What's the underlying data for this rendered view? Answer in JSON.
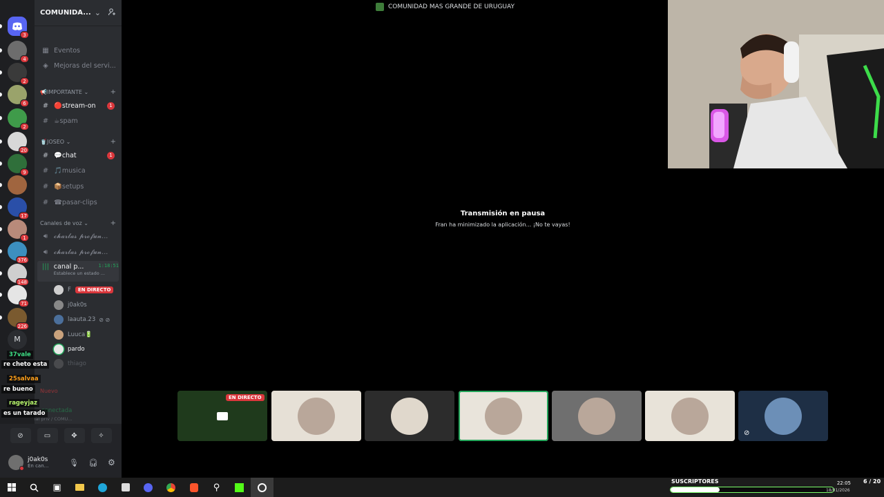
{
  "server_rail": {
    "servers": [
      {
        "name": "discord-home",
        "badge": "3",
        "color": "#5865f2"
      },
      {
        "name": "server-1",
        "badge": "4",
        "color": "#6d6d6d"
      },
      {
        "name": "server-2",
        "badge": "2",
        "color": "#3a3a3a"
      },
      {
        "name": "server-3",
        "badge": "6",
        "color": "#9aa36b"
      },
      {
        "name": "server-4",
        "badge": "2",
        "color": "#3f9b4a"
      },
      {
        "name": "server-5",
        "badge": "20",
        "color": "#d8d8d8"
      },
      {
        "name": "server-6",
        "badge": "9",
        "color": "#2f6f3a"
      },
      {
        "name": "server-7",
        "badge": "",
        "color": "#a0653f"
      },
      {
        "name": "server-8",
        "badge": "17",
        "color": "#2a4fa8"
      },
      {
        "name": "server-9",
        "badge": "1",
        "color": "#b88a7a"
      },
      {
        "name": "server-10",
        "badge": "376",
        "color": "#3c8fbf"
      },
      {
        "name": "server-11",
        "badge": "148",
        "color": "#cfcfcf"
      },
      {
        "name": "server-12",
        "badge": "71",
        "color": "#e5e5e5"
      },
      {
        "name": "server-13",
        "badge": "226",
        "color": "#7a5a2f"
      }
    ],
    "letter_server": "M"
  },
  "sidebar": {
    "server_name": "COMUNIDA...",
    "top_items": [
      {
        "label": "Eventos"
      },
      {
        "label": "Mejoras del servi..."
      }
    ],
    "category_importante": "📢IMPORTANTE",
    "importante_channels": [
      {
        "label": "🔴stream-on",
        "unread": "1"
      },
      {
        "label": "☕spam",
        "unread": ""
      }
    ],
    "category_joseo": "🥤JOSEO",
    "joseo_channels": [
      {
        "label": "💬chat",
        "unread": "1"
      },
      {
        "label": "🎵musica",
        "unread": ""
      },
      {
        "label": "📦setups",
        "unread": ""
      },
      {
        "label": "☎pasar-clips",
        "unread": ""
      }
    ],
    "category_voz": "Canales de voz",
    "voice_channels": [
      {
        "label": "𝓬𝓱𝓪𝓻𝓵𝓪𝓼 𝓹𝓻𝓸𝓯𝓾𝓷..."
      },
      {
        "label": "𝓬𝓱𝓪𝓻𝓵𝓪𝓼 𝓹𝓻𝓸𝓯𝓾𝓷..."
      }
    ],
    "active_voice": {
      "label": "canal p...",
      "timer": "1:18:51",
      "status": "Establece un estado ..."
    },
    "voice_users": [
      {
        "name": "F",
        "live": "EN DIRECTO"
      },
      {
        "name": "j0ak0s",
        "live": ""
      },
      {
        "name": "laauta.23",
        "live": ""
      },
      {
        "name": "Luuca🔋",
        "live": ""
      },
      {
        "name": "pardo",
        "live": ""
      },
      {
        "name": "thiago",
        "live": ""
      }
    ]
  },
  "chat_overlay": [
    {
      "user": "37vale",
      "color": "#3ddc84"
    },
    {
      "text": "re cheto esta",
      "color": "#ffffff"
    },
    {
      "user": "25salvaa",
      "color": "#ff9f1a"
    },
    {
      "text": "re bueno",
      "color": "#ffffff"
    },
    {
      "user": "rageyjaz",
      "color": "#b7f56b"
    },
    {
      "text": "es un tarado",
      "color": "#ffffff"
    }
  ],
  "behind_overlay": {
    "nuevo": "Nuevo",
    "connected": "conectada",
    "connected_sub": "canal priv / COMU..."
  },
  "user_panel": {
    "username": "j0ak0s",
    "status": "En can..."
  },
  "stage": {
    "title": "COMUNIDAD MAS GRANDE DE URUGUAY",
    "pause_title": "Transmisión en pausa",
    "pause_sub": "Fran ha minimizado la aplicación... ¡No te vayas!",
    "tiles": [
      {
        "name": "screen-share",
        "bg": "#1f3a1c",
        "live": "EN DIRECTO"
      },
      {
        "name": "participant-1",
        "bg": "#e6e0d6",
        "live": ""
      },
      {
        "name": "participant-2",
        "bg": "#2c2c2c",
        "live": ""
      },
      {
        "name": "participant-3",
        "bg": "#e9e4db",
        "live": ""
      },
      {
        "name": "participant-4",
        "bg": "#6f6f6f",
        "live": ""
      },
      {
        "name": "participant-5",
        "bg": "#e8e3d9",
        "live": ""
      },
      {
        "name": "participant-6",
        "bg": "#1e2f45",
        "live": ""
      }
    ]
  },
  "overlay_bar": {
    "subs_label": "SUSCRIPTORES",
    "subs_count": "6 / 20",
    "subs_progress": 0.3,
    "time": "22:05",
    "date": "18/01/2026"
  },
  "colors": {
    "discord_red": "#da373c",
    "speaking_green": "#23a55a",
    "subs_border": "#7cff6b"
  }
}
